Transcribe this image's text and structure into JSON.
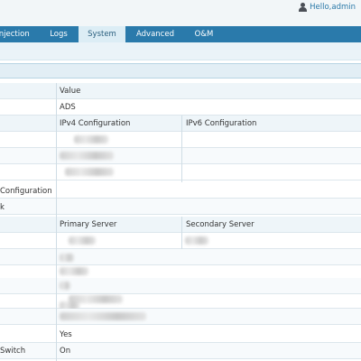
{
  "header": {
    "user_greeting": "Hello,admin"
  },
  "nav": {
    "items": [
      "Injection",
      "Logs",
      "System",
      "Advanced",
      "O&M"
    ],
    "active": "System"
  },
  "table": {
    "header_row": {
      "col1": "Value"
    },
    "rows": [
      {
        "label": "",
        "value": "ADS"
      },
      {
        "label": "",
        "col1": "IPv4 Configuration",
        "col2": "IPv6 Configuration"
      },
      {
        "label": "Configuration",
        "value": ""
      },
      {
        "label": "k",
        "value": ""
      },
      {
        "label": "",
        "col1": "Primary Server",
        "col2": "Secondary Server"
      },
      {
        "label": "",
        "value": "Yes"
      },
      {
        "label": "Switch",
        "value": "On"
      }
    ]
  },
  "colors": {
    "nav_bg": "#2a7aab",
    "accent_text": "#2a79a8"
  },
  "icons": {
    "user": "user-icon"
  }
}
